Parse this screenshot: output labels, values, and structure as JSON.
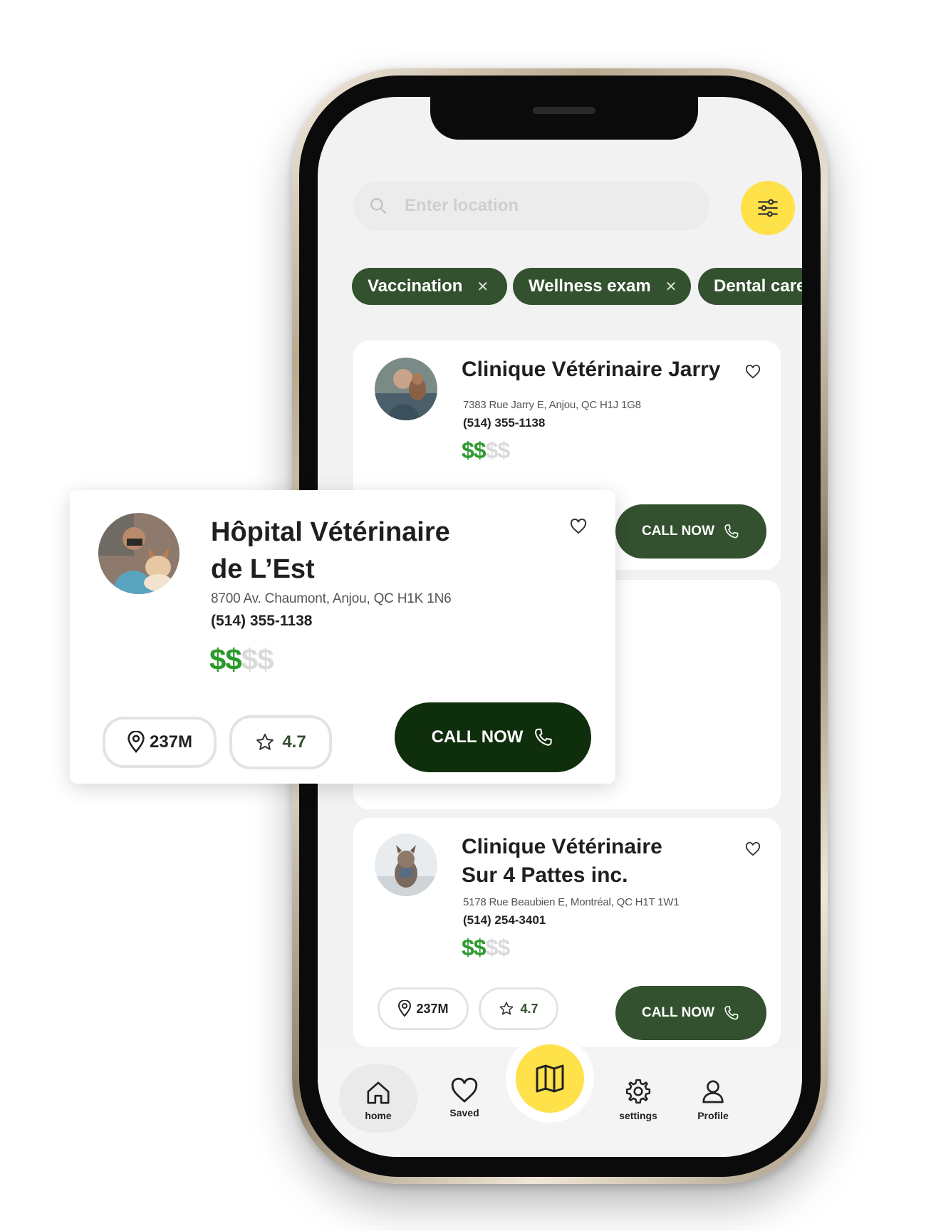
{
  "search": {
    "placeholder": "Enter location"
  },
  "chips": [
    {
      "label": "Vaccination"
    },
    {
      "label": "Wellness exam"
    },
    {
      "label": "Dental care"
    }
  ],
  "cards": [
    {
      "name": "Clinique Vétérinaire Jarry",
      "address": "7383 Rue Jarry E, Anjou, QC H1J 1G8",
      "phone": "(514) 355-1138",
      "price_active": "$$",
      "price_inactive": "$$",
      "call_label": "CALL NOW"
    },
    {
      "name_line1": "Clinique Vétérinaire",
      "name_line2": "Sur 4 Pattes inc.",
      "address": "5178 Rue Beaubien E, Montréal, QC H1T 1W1",
      "phone": "(514) 254-3401",
      "price_active": "$$",
      "price_inactive": "$$",
      "distance": "237M",
      "rating": "4.7",
      "call_label": "CALL NOW"
    }
  ],
  "featured": {
    "name_line1": "Hôpital Vétérinaire",
    "name_line2": "de L’Est",
    "address": "8700 Av. Chaumont, Anjou, QC H1K 1N6",
    "phone": "(514) 355-1138",
    "price_active": "$$",
    "price_inactive": "$$",
    "distance": "237M",
    "rating": "4.7",
    "call_label": "CALL NOW"
  },
  "nav": {
    "home": "home",
    "saved": "Saved",
    "settings": "settings",
    "profile": "Profile"
  },
  "colors": {
    "primary_green": "#33502f",
    "dark_green": "#0f2e0c",
    "price_green": "#2f9a2f",
    "accent_yellow": "#ffe14a"
  },
  "icons": [
    "search-icon",
    "filter-sliders-icon",
    "close-icon",
    "heart-icon",
    "phone-icon",
    "location-pin-icon",
    "star-icon",
    "home-icon",
    "map-icon",
    "gear-icon",
    "user-icon"
  ]
}
